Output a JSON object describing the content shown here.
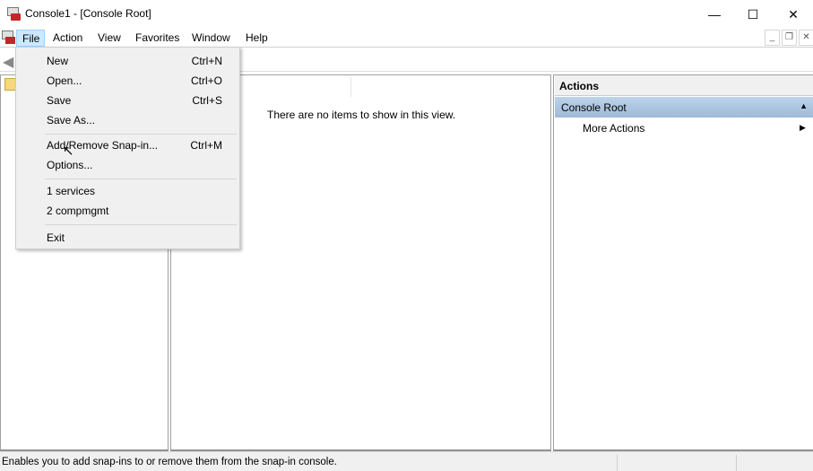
{
  "window": {
    "title": "Console1 - [Console Root]",
    "minimize": "—",
    "maximize": "☐",
    "close": "✕"
  },
  "menubar": {
    "items": [
      "File",
      "Action",
      "View",
      "Favorites",
      "Window",
      "Help"
    ],
    "mdi": {
      "minimize": "_",
      "restore": "❐",
      "close": "✕"
    }
  },
  "file_menu": {
    "items": [
      {
        "label": "New",
        "shortcut": "Ctrl+N"
      },
      {
        "label": "Open...",
        "shortcut": "Ctrl+O"
      },
      {
        "label": "Save",
        "shortcut": "Ctrl+S"
      },
      {
        "label": "Save As...",
        "shortcut": ""
      },
      {
        "label": "Add/Remove Snap-in...",
        "shortcut": "Ctrl+M"
      },
      {
        "label": "Options...",
        "shortcut": ""
      },
      {
        "label": "1 services",
        "shortcut": ""
      },
      {
        "label": "2 compmgmt",
        "shortcut": ""
      },
      {
        "label": "Exit",
        "shortcut": ""
      }
    ]
  },
  "main": {
    "empty_text": "There are no items to show in this view."
  },
  "actions": {
    "header": "Actions",
    "section": "Console Root",
    "more": "More Actions"
  },
  "status": {
    "text": "Enables you to add snap-ins to or remove them from the snap-in console."
  },
  "colors": {
    "menu_highlight": "#cce8ff",
    "actions_section": "#b0c8e2"
  }
}
